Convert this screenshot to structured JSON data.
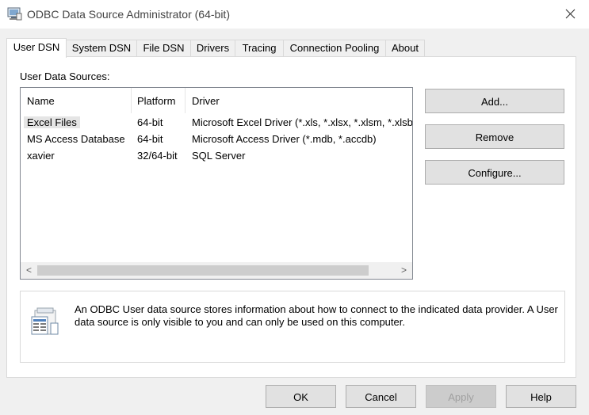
{
  "window": {
    "title": "ODBC Data Source Administrator (64-bit)"
  },
  "tabs": [
    {
      "label": "User DSN",
      "active": true
    },
    {
      "label": "System DSN",
      "active": false
    },
    {
      "label": "File DSN",
      "active": false
    },
    {
      "label": "Drivers",
      "active": false
    },
    {
      "label": "Tracing",
      "active": false
    },
    {
      "label": "Connection Pooling",
      "active": false
    },
    {
      "label": "About",
      "active": false
    }
  ],
  "panel": {
    "section_label": "User Data Sources:",
    "columns": [
      "Name",
      "Platform",
      "Driver"
    ],
    "rows": [
      {
        "name": "Excel Files",
        "platform": "64-bit",
        "driver": "Microsoft Excel Driver (*.xls, *.xlsx, *.xlsm, *.xlsb",
        "selected": true
      },
      {
        "name": "MS Access Database",
        "platform": "64-bit",
        "driver": "Microsoft Access Driver (*.mdb, *.accdb)",
        "selected": false
      },
      {
        "name": "xavier",
        "platform": "32/64-bit",
        "driver": "SQL Server",
        "selected": false
      }
    ],
    "scroll_left": "<",
    "scroll_right": ">",
    "buttons": {
      "add": "Add...",
      "remove": "Remove",
      "configure": "Configure..."
    },
    "info_text": "An ODBC User data source stores information about how to connect to the indicated data provider.   A User data source is only visible to you and can only be used on this computer."
  },
  "footer": {
    "ok": "OK",
    "cancel": "Cancel",
    "apply": "Apply",
    "help": "Help",
    "apply_disabled": true
  },
  "icons": {
    "app": "odbc-admin-icon",
    "close": "close-icon",
    "info": "data-source-icon"
  }
}
